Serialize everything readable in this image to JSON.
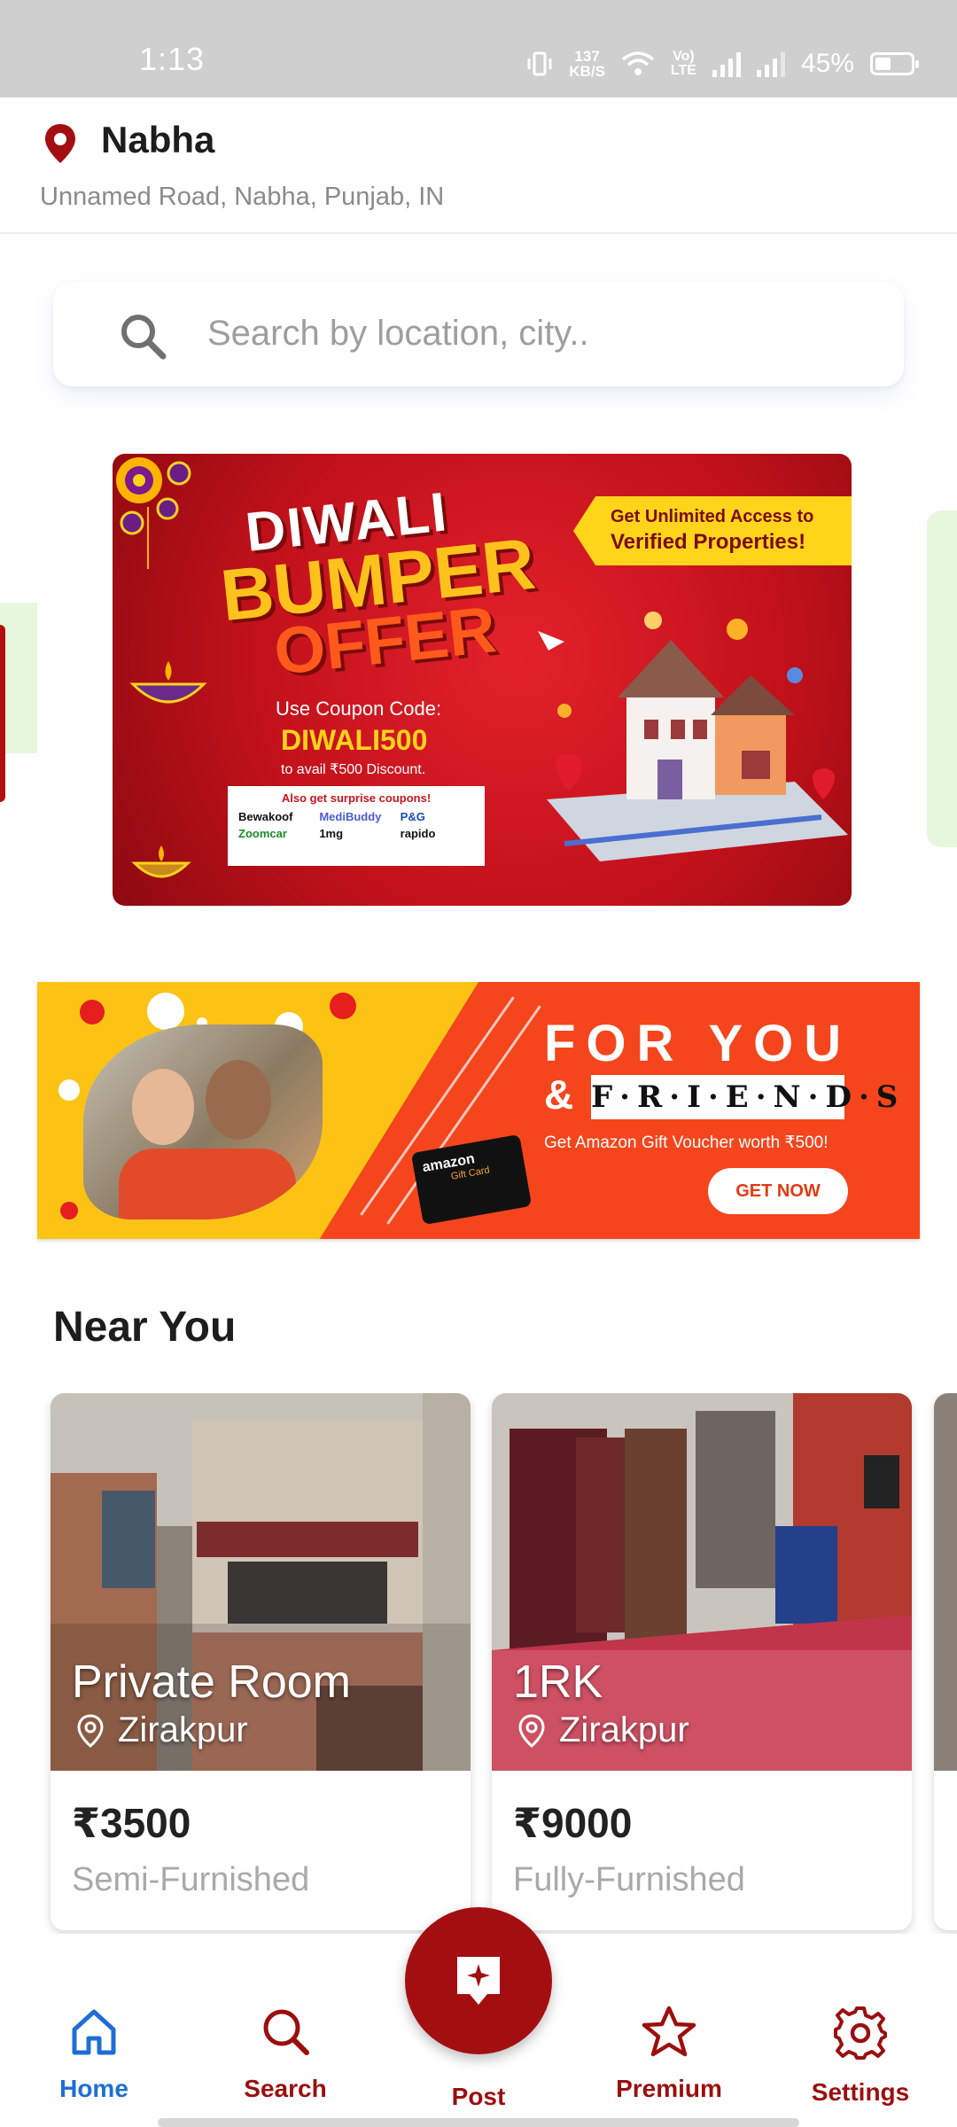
{
  "status_bar": {
    "time": "1:13",
    "net_speed_value": "137",
    "net_speed_unit": "KB/S",
    "volte_line1": "Vo)",
    "volte_line2": "LTE",
    "battery": "45%",
    "battery_level": 0.45
  },
  "header": {
    "city": "Nabha",
    "address": "Unnamed Road, Nabha, Punjab, IN",
    "pin_icon": "location-pin-icon",
    "accent_color": "#a30f10"
  },
  "search": {
    "placeholder": "Search by location, city..",
    "icon": "search-icon"
  },
  "banners": {
    "diwali": {
      "title_line1": "DIWALI",
      "title_line2": "BUMPER",
      "title_line3": "OFFER",
      "coupon_label": "Use Coupon Code:",
      "coupon_code": "DIWALI500",
      "coupon_sub": "to avail ₹500 Discount.",
      "surprise_text": "Also get surprise coupons!",
      "brands": [
        "Bewakoof",
        "MediBuddy",
        "P&G",
        "Zoomcar",
        "1mg",
        "rapido"
      ],
      "tag_line1": "Get Unlimited Access to",
      "tag_line2": "Verified Properties!"
    },
    "friends": {
      "heading": "FOR YOU",
      "amp": "&",
      "friends_word": "F·R·I·E·N·D·S",
      "subtext": "Get Amazon Gift Voucher worth ₹500!",
      "cta": "GET NOW",
      "card_brand": "amazon",
      "card_sub": "Gift Card"
    }
  },
  "near_you": {
    "title": "Near You",
    "listings": [
      {
        "type": "Private Room",
        "location": "Zirakpur",
        "price": "₹3500",
        "furnishing": "Semi-Furnished"
      },
      {
        "type": "1RK",
        "location": "Zirakpur",
        "price": "₹9000",
        "furnishing": "Fully-Furnished"
      }
    ]
  },
  "bottom_nav": {
    "items": [
      {
        "label": "Home",
        "icon": "home-icon",
        "active": true
      },
      {
        "label": "Search",
        "icon": "search-icon"
      },
      {
        "label": "Post",
        "icon": "post-sparkle-icon"
      },
      {
        "label": "Premium",
        "icon": "star-icon"
      },
      {
        "label": "Settings",
        "icon": "gear-icon"
      }
    ],
    "active_color": "#1d6fd6",
    "inactive_color": "#9b0f0f"
  }
}
